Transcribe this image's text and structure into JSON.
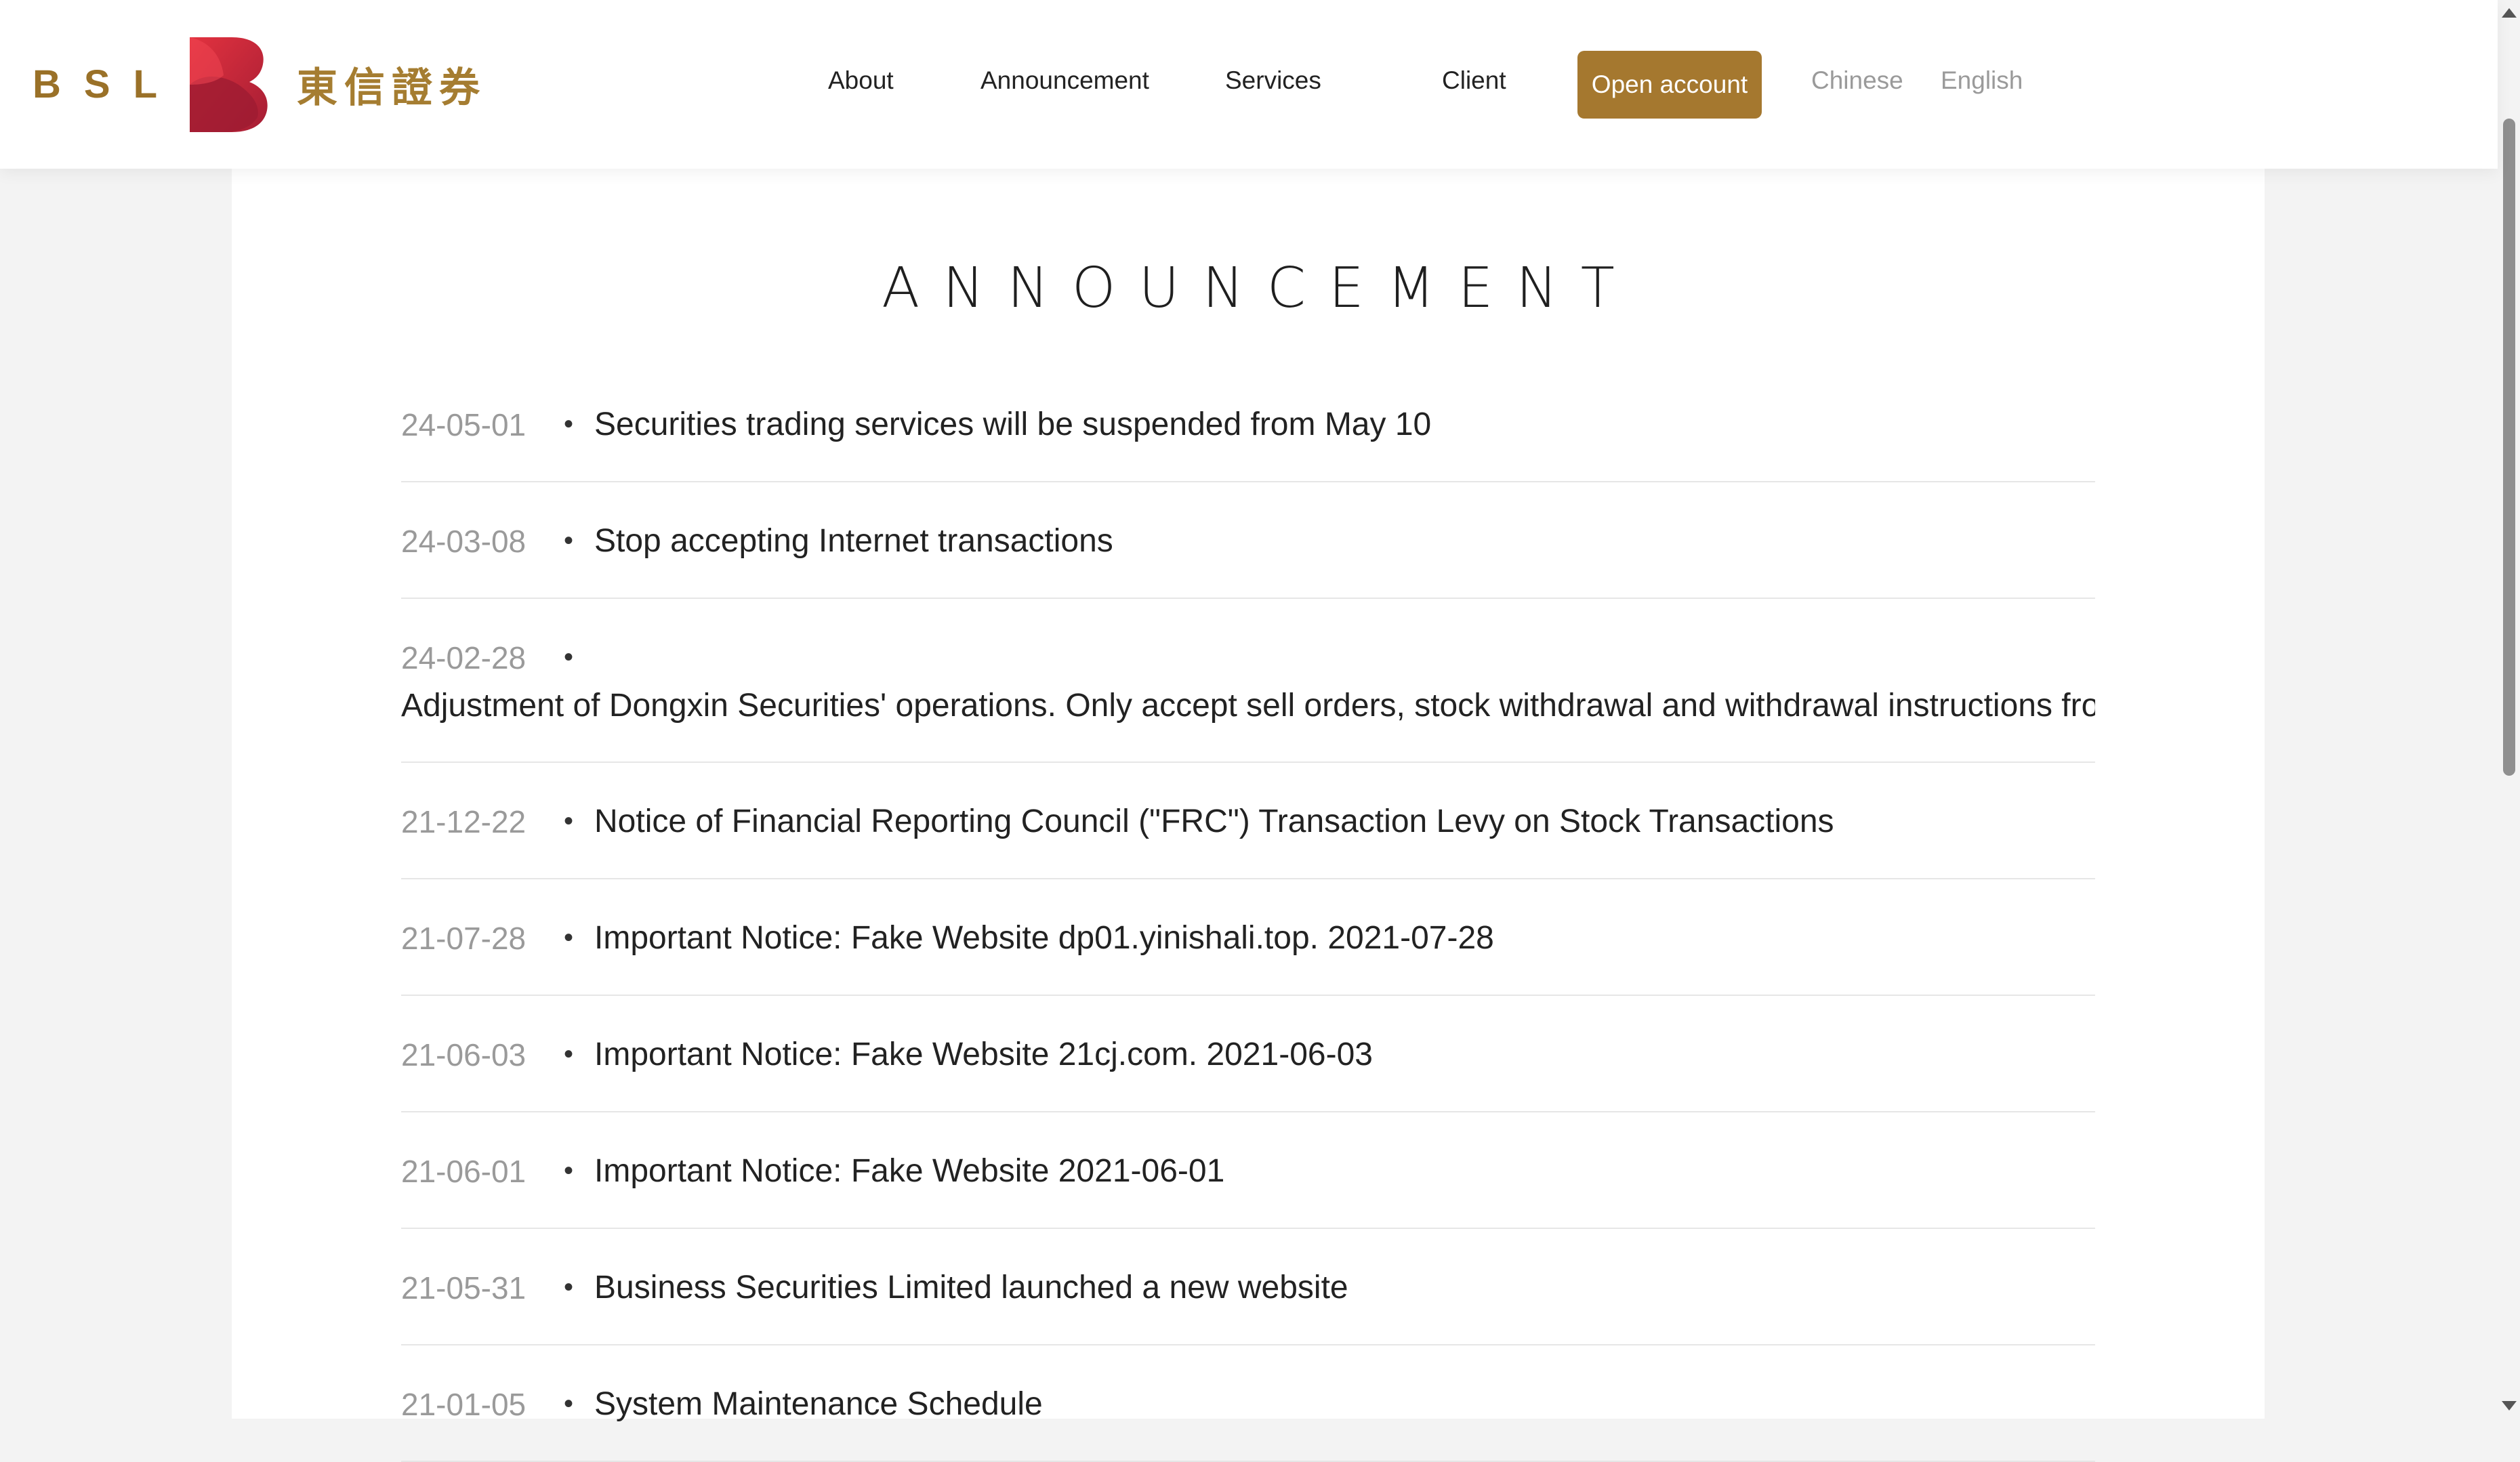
{
  "header": {
    "logo_text": "BSL",
    "logo_cn": "東信證券",
    "nav": [
      "About",
      "Announcement",
      "Services",
      "Client"
    ],
    "open_account": "Open account",
    "lang_chinese": "Chinese",
    "lang_english": "English"
  },
  "main": {
    "title": "ANNOUNCEMENT",
    "bullet": "•",
    "items": [
      {
        "date": "24-05-01",
        "title": "Securities trading services will be suspended from May 10"
      },
      {
        "date": "24-03-08",
        "title": "Stop accepting Internet transactions"
      },
      {
        "date": "24-02-28",
        "title": "Adjustment of Dongxin Securities' operations. Only accept sell orders, stock withdrawal and withdrawal instructions from customers"
      },
      {
        "date": "21-12-22",
        "title": "Notice of Financial Reporting Council (\"FRC\") Transaction Levy on Stock Transactions"
      },
      {
        "date": "21-07-28",
        "title": "Important Notice: Fake Website dp01.yinishali.top. 2021-07-28"
      },
      {
        "date": "21-06-03",
        "title": "Important Notice: Fake Website 21cj.com. 2021-06-03"
      },
      {
        "date": "21-06-01",
        "title": "Important Notice: Fake Website 2021-06-01"
      },
      {
        "date": "21-05-31",
        "title": "Business Securities Limited launched a new website"
      },
      {
        "date": "21-01-05",
        "title": "System Maintenance Schedule"
      }
    ]
  },
  "colors": {
    "accent": "#a5782f",
    "logo_red": "#c8283a",
    "text": "#222222",
    "date": "#9a9a9a"
  }
}
